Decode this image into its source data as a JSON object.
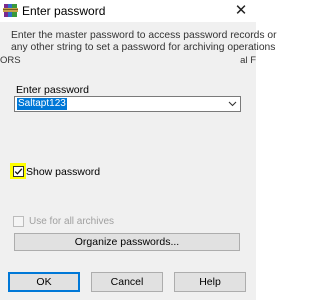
{
  "window": {
    "title": "Enter password",
    "close_glyph": "✕",
    "icon": "winrar-books-icon"
  },
  "description": {
    "line1": "Enter the master password to access password records or",
    "line2": "any other string to set a password for archiving operations"
  },
  "background": {
    "left_fragment": "ORS",
    "right_fragment": "al F"
  },
  "password": {
    "label": "Enter password",
    "value": "Saltapt123"
  },
  "show_password": {
    "label": "Show password",
    "checked": true,
    "highlight_color": "#ffff00"
  },
  "use_for_all": {
    "label": "Use for all archives",
    "checked": false,
    "enabled": false
  },
  "buttons": {
    "organize": "Organize passwords...",
    "ok": "OK",
    "cancel": "Cancel",
    "help": "Help"
  },
  "colors": {
    "accent": "#0078d7",
    "dialog_bg": "#f0f0f0"
  }
}
